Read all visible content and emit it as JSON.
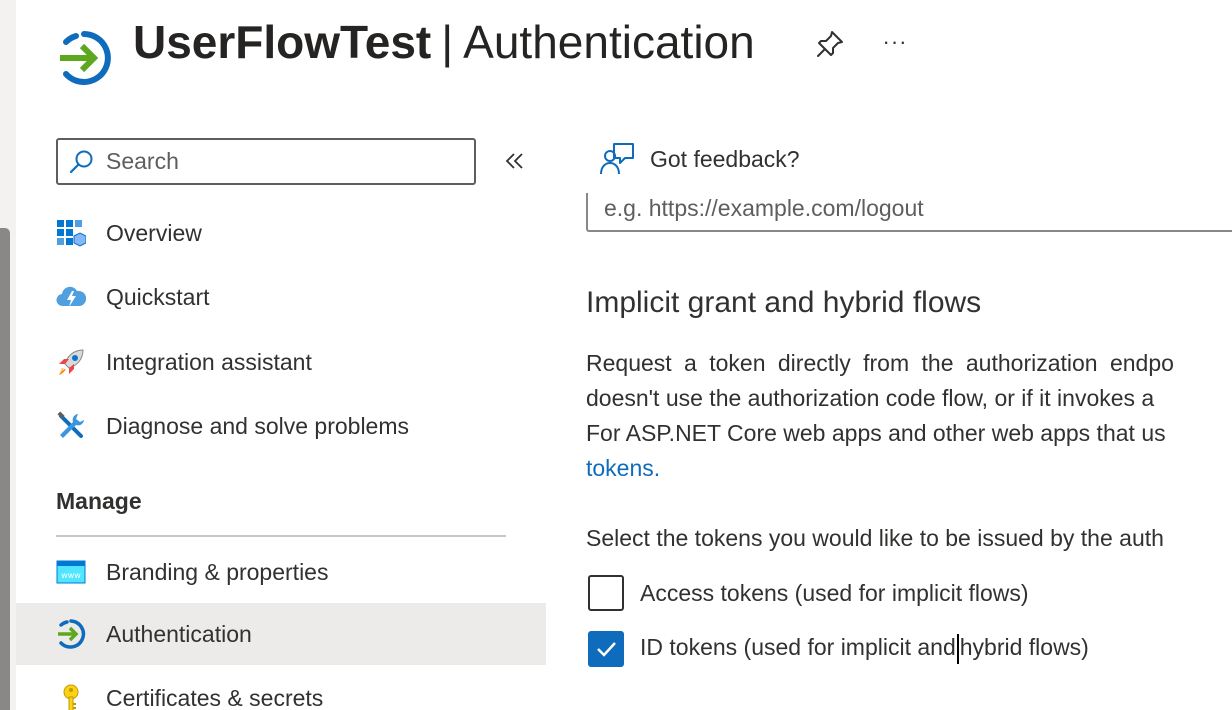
{
  "header": {
    "title_bold": "UserFlowTest",
    "title_separator": "|",
    "title_page": "Authentication",
    "more_label": "···",
    "app_icon": "sign-in-arrow-icon",
    "pin_icon": "pin-icon"
  },
  "sidebar": {
    "search_placeholder": "Search",
    "collapse_icon": "double-chevron-left-icon",
    "items": [
      {
        "label": "Overview",
        "icon": "grid-cube-icon"
      },
      {
        "label": "Quickstart",
        "icon": "cloud-lightning-icon"
      },
      {
        "label": "Integration assistant",
        "icon": "rocket-icon"
      },
      {
        "label": "Diagnose and solve problems",
        "icon": "wrench-screwdriver-icon"
      }
    ],
    "section_label": "Manage",
    "manage_items": [
      {
        "label": "Branding & properties",
        "icon": "www-window-icon"
      },
      {
        "label": "Authentication",
        "icon": "sign-in-arrow-icon",
        "selected": true
      },
      {
        "label": "Certificates & secrets",
        "icon": "key-icon"
      }
    ]
  },
  "main": {
    "feedback_label": "Got feedback?",
    "logout_url_placeholder": "e.g. https://example.com/logout",
    "section_title": "Implicit grant and hybrid flows",
    "paragraph_lines": [
      "Request a token directly from the authorization endpo",
      "doesn't use the authorization code flow, or if it invokes a",
      "For ASP.NET Core web apps and other web apps that us"
    ],
    "link_text": "tokens.",
    "select_prompt": "Select the tokens you would like to be issued by the auth",
    "checkboxes": [
      {
        "label": "Access tokens (used for implicit flows)",
        "checked": false
      },
      {
        "label_before_caret": "ID tokens (used for implicit and",
        "label_after_caret": "hybrid flows)",
        "checked": true
      }
    ]
  },
  "colors": {
    "accent": "#0f6cbd",
    "selected_bg": "#edebe9",
    "text": "#323130"
  }
}
